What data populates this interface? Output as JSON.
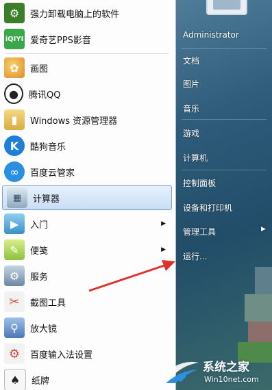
{
  "programs": [
    {
      "label": "强力卸载电脑上的软件",
      "icon": "uninstaller-icon",
      "color": "#3b7f2a"
    },
    {
      "label": "爱奇艺PPS影音",
      "icon": "iqiyi-pps-icon",
      "color": "#3aa84a"
    },
    {
      "label": "画图",
      "icon": "paint-icon",
      "color": "#e08a2a"
    },
    {
      "label": "腾讯QQ",
      "icon": "qq-penguin-icon",
      "color": "#222222"
    },
    {
      "label": "Windows 资源管理器",
      "icon": "folder-icon",
      "color": "#e8c25a"
    },
    {
      "label": "酷狗音乐",
      "icon": "kugou-icon",
      "color": "#1e7fd6"
    },
    {
      "label": "百度云管家",
      "icon": "baidu-cloud-icon",
      "color": "#2b8fe0"
    },
    {
      "label": "计算器",
      "icon": "calculator-icon",
      "color": "#7aa0bf"
    },
    {
      "label": "入门",
      "icon": "getting-started-icon",
      "color": "#49a0d8"
    },
    {
      "label": "便笺",
      "icon": "sticky-notes-icon",
      "color": "#9ccc4a"
    },
    {
      "label": "服务",
      "icon": "services-gear-icon",
      "color": "#6b86a6"
    },
    {
      "label": "截图工具",
      "icon": "snipping-tool-icon",
      "color": "#d9473a"
    },
    {
      "label": "放大镜",
      "icon": "magnifier-icon",
      "color": "#4a78b8"
    },
    {
      "label": "百度输入法设置",
      "icon": "baidu-input-settings-icon",
      "color": "#c94b3f"
    },
    {
      "label": "纸牌",
      "icon": "solitaire-icon",
      "color": "#c8c8c8"
    }
  ],
  "right_pane": {
    "user": "Administrator",
    "items": [
      {
        "label": "文档"
      },
      {
        "label": "图片"
      },
      {
        "label": "音乐"
      },
      {
        "label": "游戏"
      },
      {
        "label": "计算机"
      },
      {
        "label": "控制面板"
      },
      {
        "label": "设备和打印机"
      },
      {
        "label": "管理工具"
      },
      {
        "label": "运行..."
      }
    ]
  },
  "watermark": {
    "title": "系统之家",
    "url": "Win10net.com"
  }
}
